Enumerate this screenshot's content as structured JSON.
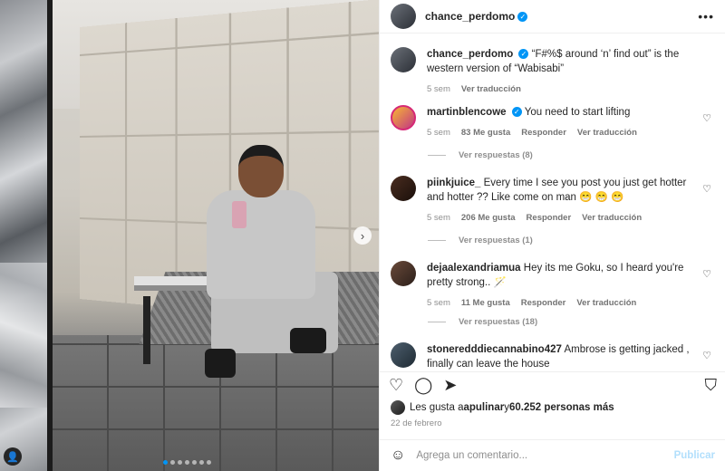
{
  "post": {
    "author": "chance_perdomo",
    "carousel_count": 7,
    "carousel_active": 1
  },
  "caption": {
    "username": "chance_perdomo",
    "text": "“F#%$ around ‘n’ find out” is the western version of “Wabisabi”",
    "time": "5 sem",
    "translate": "Ver traducción"
  },
  "comments": [
    {
      "username": "martinblencowe",
      "text": "You need to start lifting",
      "time": "5 sem",
      "likes": "83 Me gusta",
      "reply": "Responder",
      "translate": "Ver traducción",
      "replies": "Ver respuestas (8)"
    },
    {
      "username": "piinkjuice_",
      "text": "Every time I see you post you just get hotter and hotter ?? Like come on man 😁 😁 😁",
      "time": "5 sem",
      "likes": "206 Me gusta",
      "reply": "Responder",
      "translate": "Ver traducción",
      "replies": "Ver respuestas (1)"
    },
    {
      "username": "dejaalexandriamua",
      "text": "Hey its me Goku, so I heard you're pretty strong.. 🪄",
      "time": "5 sem",
      "likes": "11 Me gusta",
      "reply": "Responder",
      "translate": "Ver traducción",
      "replies": "Ver respuestas (18)"
    },
    {
      "username": "stoneredddiecannabino427",
      "text": "Ambrose is getting jacked , finally can leave the house"
    }
  ],
  "likes": {
    "prefix": "Les gusta a ",
    "user": "apulinar",
    "mid": " y ",
    "count": "60.252 personas más"
  },
  "date": "22 de febrero",
  "composer": {
    "placeholder": "Agrega un comentario...",
    "publish": "Publicar"
  },
  "icons": {
    "more": "ellipsis-icon",
    "like": "heart-icon",
    "comment": "comment-icon",
    "share": "send-icon",
    "save": "bookmark-icon",
    "emoji": "emoji-icon",
    "next": "chevron-right-icon"
  },
  "colors": {
    "verified": "#0095f6",
    "publish_disabled": "#b2dffc"
  }
}
